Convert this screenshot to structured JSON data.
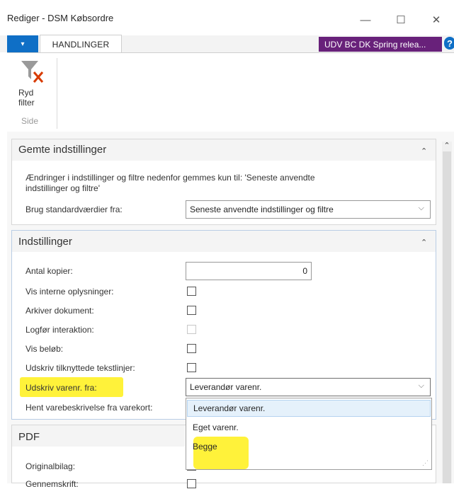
{
  "window": {
    "title": "Rediger - DSM Købsordre",
    "minimize": "—",
    "maximize": "☐",
    "close": "✕"
  },
  "ribbon": {
    "file_glyph": "▾",
    "tab": "HANDLINGER",
    "environment": "UDV BC DK Spring relea...",
    "help": "?",
    "clear_filter_label": "Ryd filter",
    "group_label": "Side"
  },
  "saved": {
    "title": "Gemte indstillinger",
    "collapse": "⌃",
    "note": "Ændringer i indstillinger og filtre nedenfor gemmes kun til: 'Seneste anvendte indstillinger og filtre'",
    "defaults_label": "Brug standardværdier fra:",
    "defaults_value": "Seneste anvendte indstillinger og filtre"
  },
  "settings": {
    "title": "Indstillinger",
    "collapse": "⌃",
    "copies_label": "Antal kopier:",
    "copies_value": "0",
    "show_internal_label": "Vis interne oplysninger:",
    "archive_label": "Arkiver dokument:",
    "log_interaction_label": "Logfør interaktion:",
    "show_amounts_label": "Vis beløb:",
    "print_text_lines_label": "Udskriv tilknyttede tekstlinjer:",
    "print_item_no_label": "Udskriv varenr. fra:",
    "print_item_no_value": "Leverandør varenr.",
    "fetch_desc_label": "Hent varebeskrivelse fra varekort:",
    "options": [
      "Leverandør varenr.",
      "Eget varenr.",
      "Begge"
    ]
  },
  "pdf": {
    "title": "PDF",
    "original_label": "Originalbilag:",
    "copy_label": "Gennemskrift:"
  },
  "colors": {
    "accent": "#0f6fc6",
    "env_badge": "#68217a",
    "highlight": "#fff23a",
    "selected": "#e5f1fb"
  }
}
